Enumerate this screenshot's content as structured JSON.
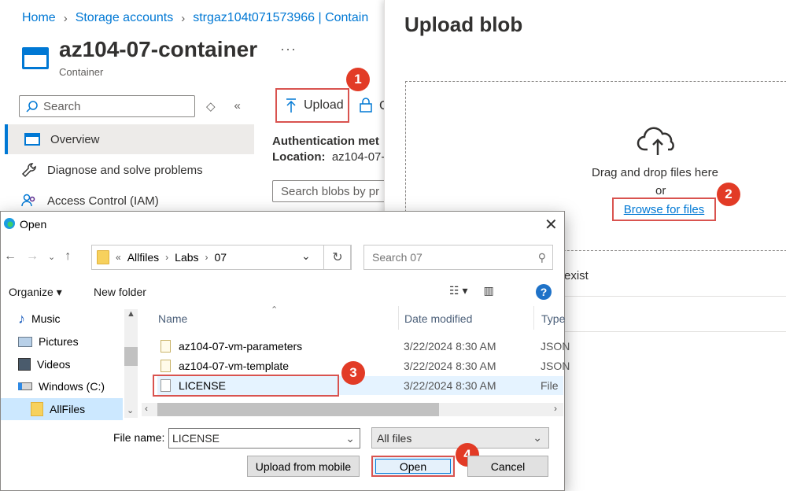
{
  "breadcrumb": [
    "Home",
    "Storage accounts",
    "strgaz104t071573966 | Contain"
  ],
  "resource": {
    "title": "az104-07-container",
    "subtitle": "Container",
    "more": "···"
  },
  "sidebar": {
    "search_placeholder": "Search",
    "items": [
      {
        "label": "Overview",
        "icon": "container-icon",
        "active": true
      },
      {
        "label": "Diagnose and solve problems",
        "icon": "wrench-icon"
      },
      {
        "label": "Access Control (IAM)",
        "icon": "people-icon"
      }
    ]
  },
  "toolbar": {
    "upload_label": "Upload",
    "next_label": "C"
  },
  "container_info": {
    "auth_label": "Authentication met",
    "location_label": "Location:",
    "location_value": "az104-07-",
    "blob_search_placeholder": "Search blobs by pr"
  },
  "upload_panel": {
    "title": "Upload blob",
    "drag_text": "Drag and drop files here",
    "or_text": "or",
    "browse_label": "Browse for files",
    "overwrite_fragment": "exist"
  },
  "dialog": {
    "title": "Open",
    "path": [
      "Allfiles",
      "Labs",
      "07"
    ],
    "search_placeholder": "Search 07",
    "organize_label": "Organize ▾",
    "new_folder_label": "New folder",
    "tree": [
      {
        "label": "Music",
        "icon": "music-icon"
      },
      {
        "label": "Pictures",
        "icon": "pictures-icon"
      },
      {
        "label": "Videos",
        "icon": "videos-icon"
      },
      {
        "label": "Windows (C:)",
        "icon": "drive-icon"
      },
      {
        "label": "AllFiles",
        "icon": "folder-icon",
        "selected": true
      }
    ],
    "columns": {
      "name": "Name",
      "date": "Date modified",
      "type": "Type"
    },
    "files": [
      {
        "name": "az104-07-vm-parameters",
        "date": "3/22/2024 8:30 AM",
        "type": "JSON"
      },
      {
        "name": "az104-07-vm-template",
        "date": "3/22/2024 8:30 AM",
        "type": "JSON"
      },
      {
        "name": "LICENSE",
        "date": "3/22/2024 8:30 AM",
        "type": "File"
      }
    ],
    "file_name_label": "File name:",
    "file_name_value": "LICENSE",
    "file_type_value": "All files",
    "upload_mobile_label": "Upload from mobile",
    "open_label": "Open",
    "cancel_label": "Cancel"
  },
  "steps": [
    "1",
    "2",
    "3",
    "4"
  ],
  "colors": {
    "accent": "#0078d4",
    "callout": "#e23b26",
    "highlight": "#d9534f"
  }
}
